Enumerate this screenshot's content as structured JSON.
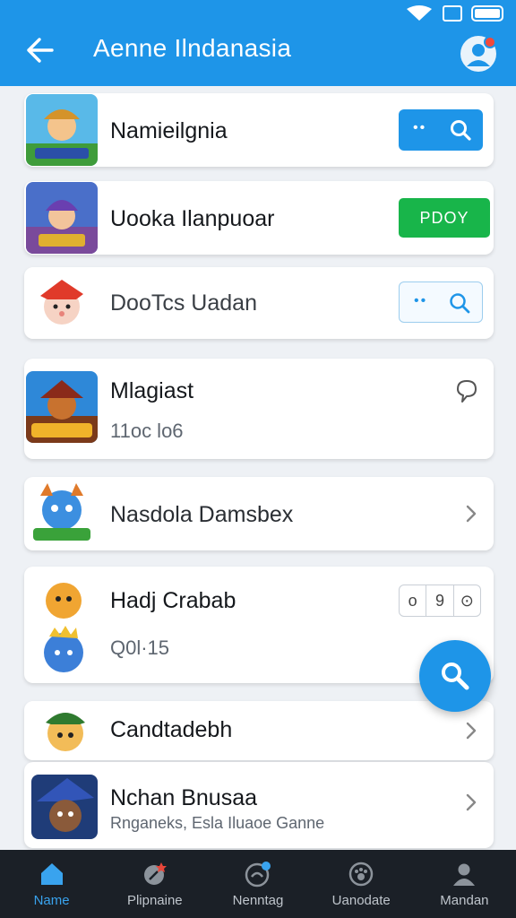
{
  "appbar": {
    "title": "Aenne Ilndanasia",
    "back_icon": "arrow-left-icon",
    "profile_icon": "profile-icon"
  },
  "colors": {
    "primary": "#1e95e8",
    "play": "#18b54a",
    "nav_bg": "#1b2027"
  },
  "list": [
    {
      "name": "Namieilgnia",
      "action": "search"
    },
    {
      "name": "Uooka Ilanpuoar",
      "action": "play",
      "action_label": "PDOY"
    },
    {
      "name": "DooTcs Uadan",
      "action": "search-outline"
    },
    {
      "name": "Mlagiast",
      "sub": "11oc lo6",
      "action": "favorite"
    },
    {
      "name": "Nasdola Damsbex",
      "action": "chevron"
    },
    {
      "name": "Hadj Crabab",
      "sub": "Q0l·15",
      "action": "triple",
      "triple": [
        "o",
        "9",
        "⊙"
      ]
    },
    {
      "name": "Candtadebh",
      "action": "chevron"
    },
    {
      "name": "Nchan Bnusaa",
      "sub": "Rnganeks, Esla Iluaoe Ganne",
      "action": "chevron"
    }
  ],
  "fab": {
    "icon": "search-icon"
  },
  "bottom_nav": [
    {
      "label": "Name",
      "icon": "home-icon",
      "active": true
    },
    {
      "label": "Plipnaine",
      "icon": "pin-icon"
    },
    {
      "label": "Nenntag",
      "icon": "game-controller-icon"
    },
    {
      "label": "Uanodate",
      "icon": "paw-icon"
    },
    {
      "label": "Mandan",
      "icon": "person-icon"
    }
  ]
}
